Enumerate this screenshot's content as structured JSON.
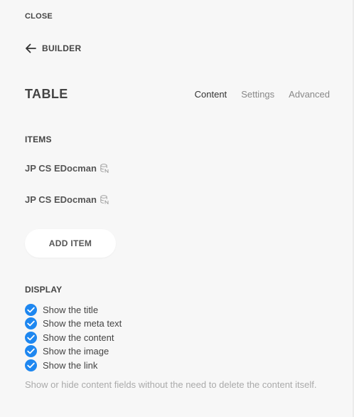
{
  "header": {
    "close_label": "CLOSE",
    "back_label": "BUILDER",
    "back_icon": "arrow-left-icon"
  },
  "title": "TABLE",
  "tabs": [
    {
      "label": "Content",
      "active": true
    },
    {
      "label": "Settings",
      "active": false
    },
    {
      "label": "Advanced",
      "active": false
    }
  ],
  "items_section": {
    "heading": "ITEMS",
    "items": [
      {
        "label": "JP CS EDocman",
        "icon": "dynamic-content-icon"
      },
      {
        "label": "JP CS EDocman",
        "icon": "dynamic-content-icon"
      }
    ],
    "add_label": "ADD ITEM"
  },
  "display_section": {
    "heading": "DISPLAY",
    "options": [
      {
        "label": "Show the title",
        "checked": true
      },
      {
        "label": "Show the meta text",
        "checked": true
      },
      {
        "label": "Show the content",
        "checked": true
      },
      {
        "label": "Show the image",
        "checked": true
      },
      {
        "label": "Show the link",
        "checked": true
      }
    ],
    "hint": "Show or hide content fields without the need to delete the content itself."
  },
  "colors": {
    "accent": "#1e87f0",
    "background": "#f7f7f7",
    "text": "#444444",
    "muted": "#aaaaaa"
  }
}
